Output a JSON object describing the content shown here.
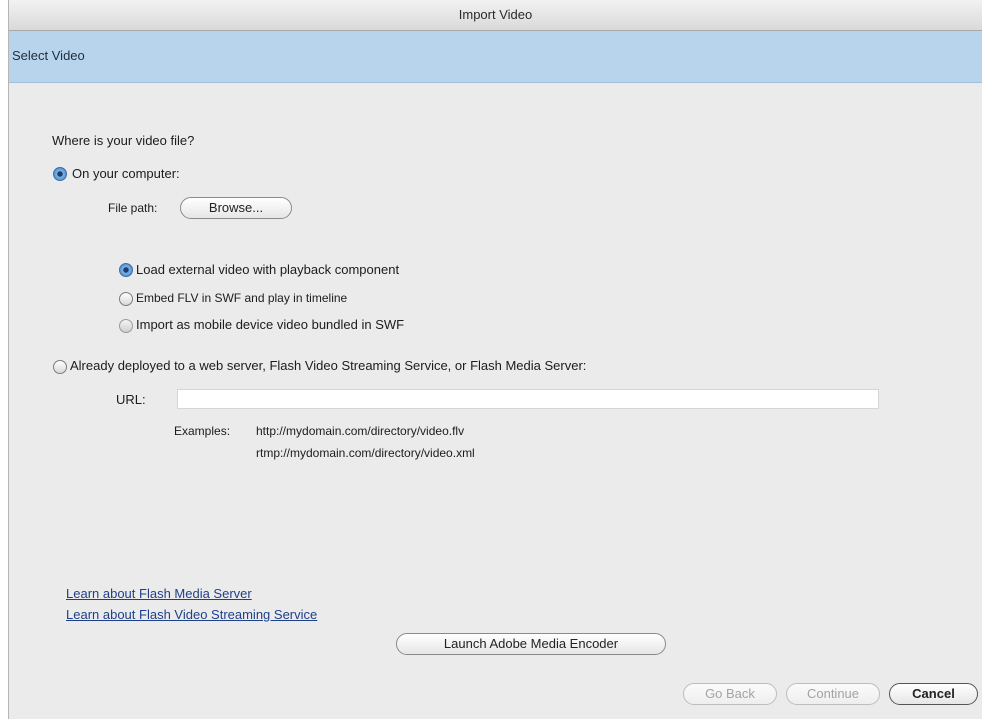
{
  "window": {
    "title": "Import Video"
  },
  "header": {
    "title": "Select Video"
  },
  "form": {
    "question": "Where is your video file?",
    "option_computer": {
      "label": "On your computer:",
      "selected": true
    },
    "file_path_label": "File path:",
    "browse_label": "Browse...",
    "sub_options": [
      {
        "label": "Load external video with playback component",
        "selected": true
      },
      {
        "label": "Embed FLV in SWF and play in timeline",
        "selected": false
      },
      {
        "label": "Import as mobile device video bundled in SWF",
        "selected": false
      }
    ],
    "option_server": {
      "label": "Already deployed to a web server, Flash Video Streaming Service, or Flash Media Server:",
      "selected": false
    },
    "url_label": "URL:",
    "url_value": "",
    "examples_label": "Examples:",
    "examples": [
      "http://mydomain.com/directory/video.flv",
      "rtmp://mydomain.com/directory/video.xml"
    ]
  },
  "links": {
    "fms": "Learn about Flash Media Server",
    "fvss": "Learn about Flash Video Streaming Service"
  },
  "encoder_button": "Launch Adobe Media Encoder",
  "footer": {
    "go_back": "Go Back",
    "continue": "Continue",
    "cancel": "Cancel"
  },
  "colors": {
    "header_bg": "#b8d4ec",
    "window_bg": "#ebebeb",
    "link": "#1f3f8a"
  }
}
